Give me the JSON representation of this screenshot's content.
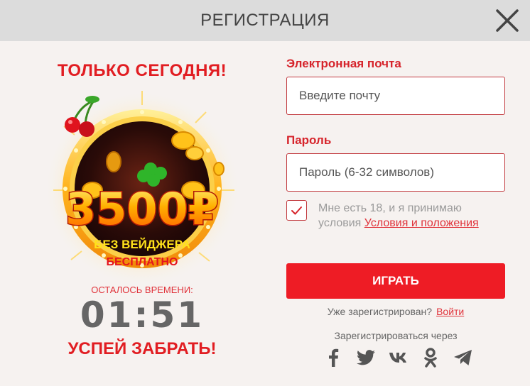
{
  "header": {
    "title": "РЕГИСТРАЦИЯ"
  },
  "promo": {
    "headline": "ТОЛЬКО СЕГОДНЯ!",
    "amount": "3500₽",
    "line1": "БЕЗ ВЕЙДЖЕРА",
    "line2": "БЕСПЛАТНО",
    "time_label": "ОСТАЛОСЬ ВРЕМЕНИ:",
    "timer": "01:51",
    "cta": "УСПЕЙ ЗАБРАТЬ!"
  },
  "form": {
    "email_label": "Электронная почта",
    "email_placeholder": "Введите почту",
    "password_label": "Пароль",
    "password_placeholder": "Пароль (6-32 символов)",
    "agree_text": "Мне есть 18, и я принимаю условия",
    "agree_link": "Условия и положения",
    "agree_checked": true,
    "play_button": "ИГРАТЬ",
    "already_text": "Уже зарегистрирован?",
    "login_link": "Войти",
    "social_text": "Зарегистрироваться через",
    "socials": [
      "facebook-icon",
      "twitter-icon",
      "vk-icon",
      "odnoklassniki-icon",
      "telegram-icon"
    ]
  },
  "colors": {
    "accent": "#ee1c25",
    "header_bg": "#dcdcdc",
    "background": "#f6f2f0"
  }
}
